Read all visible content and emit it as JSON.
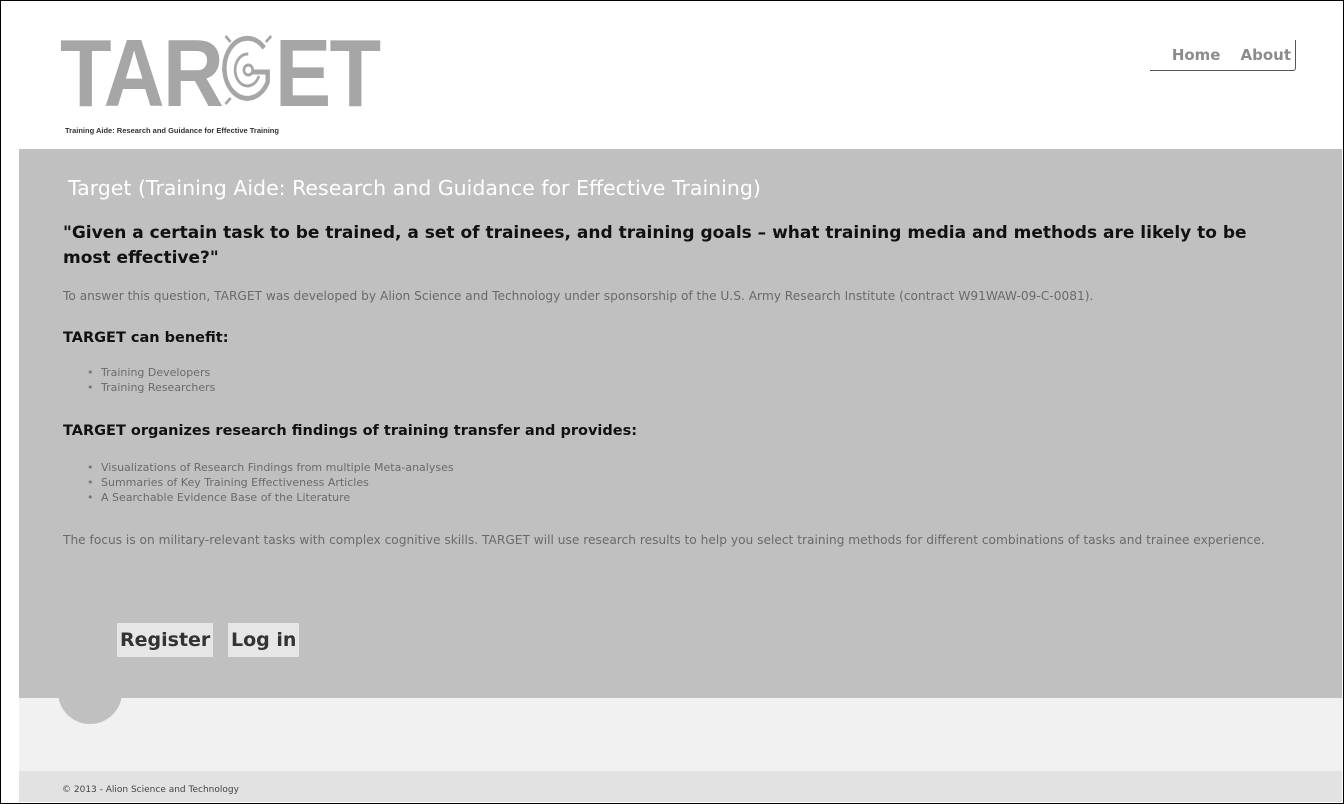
{
  "logo": {
    "word_left": "TAR",
    "word_right": "ET",
    "tagline": "Training Aide: Research and Guidance for Effective Training"
  },
  "nav": {
    "items": [
      {
        "label": "Home"
      },
      {
        "label": "About"
      }
    ]
  },
  "featured": {
    "title": "Target (Training Aide: Research and Guidance for Effective Training)",
    "quote": "\"Given a certain task to be trained, a set of trainees, and training goals – what training media and methods are likely to be most effective?\"",
    "intro": "To answer this question, TARGET was developed by Alion Science and Technology under sponsorship of the U.S. Army Research Institute (contract W91WAW-09-C-0081).",
    "benefit_heading": "TARGET can benefit:",
    "benefit_items": [
      "Training Developers",
      "Training Researchers"
    ],
    "provides_heading": "TARGET organizes research findings of training transfer and provides:",
    "provides_items": [
      "Visualizations of Research Findings from multiple Meta-analyses",
      "Summaries of Key Training Effectiveness Articles",
      "A Searchable Evidence Base of the Literature"
    ],
    "focus": "The focus is on military-relevant tasks with complex cognitive skills. TARGET will use research results to help you select training methods for different combinations of tasks and trainee experience.",
    "register_label": "Register",
    "login_label": "Log in"
  },
  "footer": {
    "copyright": "© 2013 - Alion Science and Technology"
  },
  "colors": {
    "panel": "#c0c0c0",
    "logo": "#a6a6a6",
    "button_bg": "#e6e6e6",
    "footer_bg": "#e2e2e2"
  }
}
